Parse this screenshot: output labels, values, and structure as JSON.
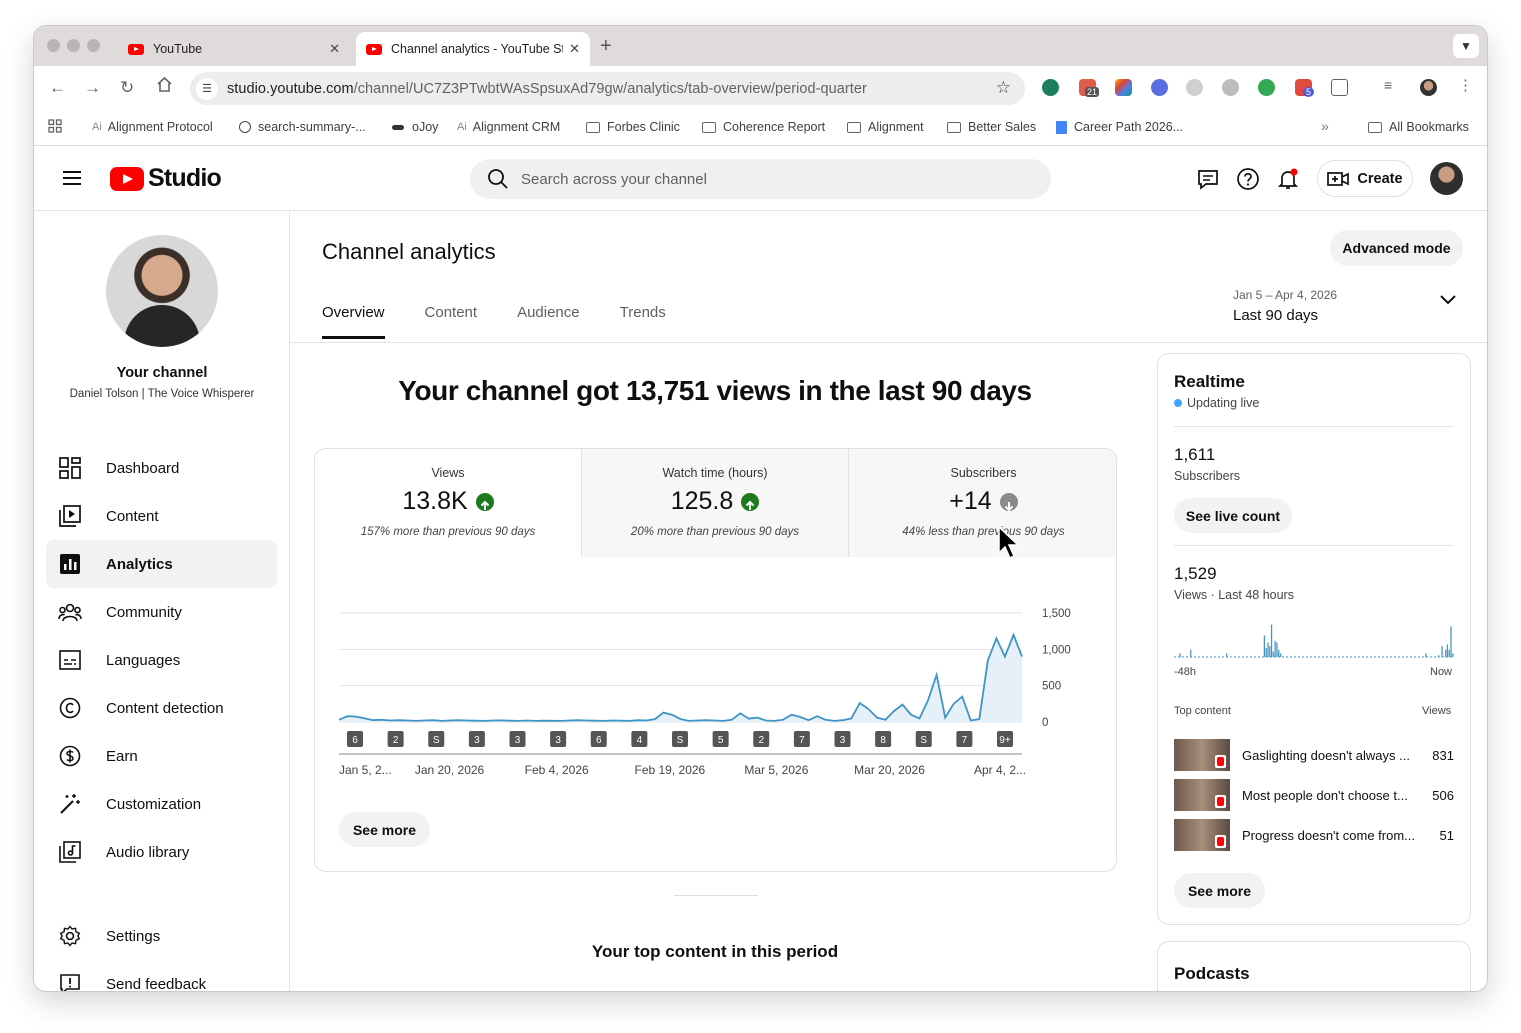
{
  "browser": {
    "tabs": [
      {
        "title": "YouTube",
        "close": "✕"
      },
      {
        "title": "Channel analytics - YouTube Studio",
        "close": "✕"
      }
    ],
    "new_tab": "+",
    "url_domain": "studio.youtube.com",
    "url_path": "/channel/UC7Z3PTwbtWAsSpsuxAd79gw/analytics/tab-overview/period-quarter",
    "extension_badges": [
      "21",
      "5"
    ],
    "bookmarks": [
      "Alignment Protocol",
      "search-summary-...",
      "oJoy",
      "Alignment CRM",
      "Forbes Clinic",
      "Coherence Report",
      "Alignment",
      "Better Sales",
      "Career Path 2026...",
      "All Bookmarks"
    ],
    "bookmarks_overflow": "»"
  },
  "studio": {
    "logo_text": "Studio",
    "search_placeholder": "Search across your channel",
    "create_label": "Create"
  },
  "sidebar": {
    "channel_title": "Your channel",
    "channel_name": "Daniel Tolson | The Voice Whisperer",
    "items": [
      {
        "label": "Dashboard",
        "icon": "dashboard-icon"
      },
      {
        "label": "Content",
        "icon": "content-icon"
      },
      {
        "label": "Analytics",
        "icon": "analytics-icon",
        "active": true
      },
      {
        "label": "Community",
        "icon": "community-icon"
      },
      {
        "label": "Languages",
        "icon": "languages-icon"
      },
      {
        "label": "Content detection",
        "icon": "copyright-icon"
      },
      {
        "label": "Earn",
        "icon": "dollar-icon"
      },
      {
        "label": "Customization",
        "icon": "magic-wand-icon"
      },
      {
        "label": "Audio library",
        "icon": "audio-library-icon"
      },
      {
        "label": "Settings",
        "icon": "gear-icon"
      },
      {
        "label": "Send feedback",
        "icon": "feedback-icon"
      }
    ]
  },
  "main": {
    "title": "Channel analytics",
    "advanced_mode": "Advanced mode",
    "tabs": [
      "Overview",
      "Content",
      "Audience",
      "Trends"
    ],
    "period_range": "Jan 5 – Apr 4, 2026",
    "period_label": "Last 90 days",
    "headline": "Your channel got 13,751 views in the last 90 days",
    "metrics": [
      {
        "label": "Views",
        "value": "13.8K",
        "trend": "up",
        "note": "157% more than previous 90 days"
      },
      {
        "label": "Watch time (hours)",
        "value": "125.8",
        "trend": "up",
        "note": "20% more than previous 90 days"
      },
      {
        "label": "Subscribers",
        "value": "+14",
        "trend": "down",
        "note": "44% less than previous 90 days"
      }
    ],
    "see_more": "See more",
    "top_content_title": "Your top content in this period"
  },
  "colors": {
    "up": "#1f7a1f",
    "down": "#8a8a8a",
    "line": "#3f94c4",
    "area": "#e6f0f8",
    "live": "#3ea6ff",
    "brand": "#ff0000"
  },
  "chart_data": {
    "type": "line",
    "series": [
      {
        "values": [
          30,
          80,
          75,
          50,
          25,
          30,
          20,
          25,
          20,
          15,
          20,
          25,
          15,
          20,
          25,
          20,
          18,
          15,
          20,
          22,
          18,
          15,
          20,
          15,
          18,
          16,
          15,
          20,
          25,
          20,
          18,
          15,
          20,
          18,
          15,
          25,
          20,
          40,
          130,
          100,
          40,
          15,
          20,
          25,
          20,
          15,
          30,
          120,
          45,
          60,
          20,
          15,
          30,
          100,
          70,
          25,
          80,
          30,
          15,
          25,
          50,
          260,
          180,
          60,
          30,
          150,
          240,
          100,
          50,
          300,
          650,
          60,
          250,
          350,
          20,
          40,
          850,
          1150,
          900,
          1200,
          900
        ]
      }
    ],
    "ylim": [
      0,
      1500
    ],
    "yticks": [
      "1,500",
      "1,000",
      "500",
      "0"
    ],
    "xticks": [
      "Jan 5, 2...",
      "Jan 20, 2026",
      "Feb 4, 2026",
      "Feb 19, 2026",
      "Mar 5, 2026",
      "Mar 20, 2026",
      "Apr 4, 2..."
    ],
    "markers": [
      "6",
      "2",
      "short",
      "3",
      "3",
      "3",
      "6",
      "4",
      "short",
      "5",
      "2",
      "7",
      "3",
      "8",
      "short",
      "7",
      "9+"
    ]
  },
  "realtime": {
    "title": "Realtime",
    "live_text": "Updating live",
    "subscribers_count": "1,611",
    "subscribers_label": "Subscribers",
    "see_live_count": "See live count",
    "views_count": "1,529",
    "views_label": "Views · Last 48 hours",
    "axis_start": "-48h",
    "axis_end": "Now",
    "bars": [
      0,
      0,
      0,
      0.1,
      0,
      0,
      0,
      0,
      0,
      0.2,
      0,
      0,
      0,
      0,
      0,
      0,
      0,
      0,
      0,
      0,
      0,
      0,
      0,
      0,
      0,
      0,
      0,
      0,
      0,
      0.1,
      0,
      0,
      0,
      0,
      0,
      0,
      0,
      0,
      0,
      0,
      0,
      0,
      0,
      0,
      0,
      0,
      0,
      0,
      0,
      0,
      0.6,
      0.25,
      0.4,
      0.3,
      0.9,
      0.15,
      0.45,
      0.4,
      0.2,
      0.1,
      0,
      0,
      0,
      0,
      0,
      0,
      0,
      0,
      0,
      0,
      0,
      0,
      0,
      0,
      0,
      0,
      0,
      0,
      0,
      0,
      0,
      0,
      0,
      0,
      0,
      0,
      0,
      0,
      0,
      0,
      0,
      0,
      0,
      0,
      0,
      0,
      0,
      0,
      0,
      0,
      0,
      0,
      0,
      0,
      0,
      0,
      0,
      0,
      0,
      0,
      0,
      0,
      0,
      0,
      0,
      0,
      0,
      0,
      0,
      0,
      0,
      0,
      0,
      0,
      0,
      0,
      0,
      0,
      0,
      0,
      0,
      0,
      0,
      0,
      0,
      0,
      0,
      0,
      0,
      0,
      0.1,
      0,
      0,
      0,
      0,
      0,
      0,
      0.05,
      0,
      0.3,
      0,
      0.2,
      0.35,
      0.2,
      0.85,
      0.1
    ],
    "top_content_label": "Top content",
    "views_col_label": "Views",
    "top_content": [
      {
        "title": "Gaslighting doesn't always ...",
        "views": "831"
      },
      {
        "title": "Most people don't choose t...",
        "views": "506"
      },
      {
        "title": "Progress doesn't come from...",
        "views": "51"
      }
    ],
    "see_more": "See more"
  },
  "podcasts": {
    "title": "Podcasts"
  }
}
